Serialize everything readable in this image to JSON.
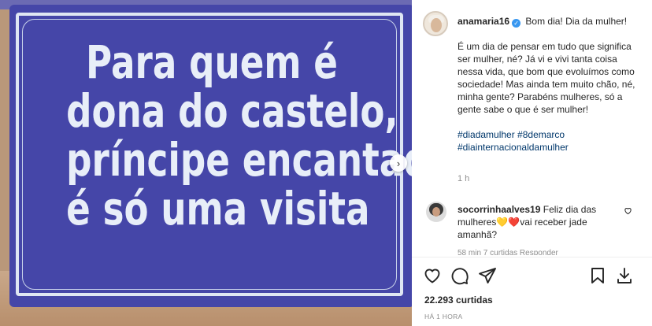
{
  "media": {
    "sign_lines": [
      "Para quem é",
      "dona do castelo, o",
      "príncipe encantado",
      "é só uma visita"
    ],
    "next_button_glyph": "›"
  },
  "post": {
    "username": "anamaria16",
    "verified_glyph": "✓",
    "caption_first": "Bom dia! Dia da mulher!",
    "caption_body": "É um dia de pensar em tudo que significa ser mulher, né? Já vi e vivi tanta coisa nessa vida, que bom que evoluímos como sociedade! Mas ainda tem muito chão, né, minha gente? Parabéns mulheres, só a gente sabe o que é ser mulher!",
    "hashtags_line1": "#diadamulher #8demarco",
    "hashtags_line2": "#diainternacionaldamulher",
    "time": "1 h"
  },
  "comment": {
    "username": "socorrinhaalves19",
    "text": "Feliz dia das mulheres💛❤️vai receber jade amanhã?",
    "meta": "58 min   7 curtidas   Responder"
  },
  "actions": {
    "like_icon": "heart-icon",
    "comment_icon": "comment-icon",
    "share_icon": "share-icon",
    "save_icon": "bookmark-icon",
    "download_icon": "download-icon"
  },
  "stats": {
    "likes": "22.293 curtidas",
    "time_ago": "HÁ 1 HORA"
  },
  "colors": {
    "sign_blue": "#4546a8",
    "link_blue": "#00376b",
    "verified_blue": "#3897f0"
  }
}
